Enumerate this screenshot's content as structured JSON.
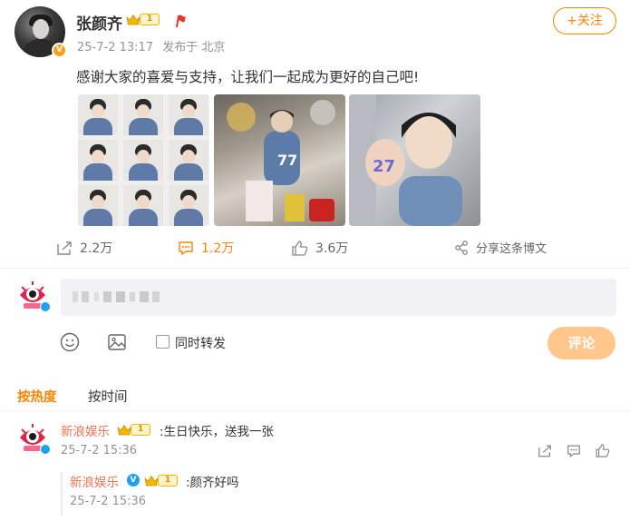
{
  "post": {
    "username": "张颜齐",
    "level": "1",
    "verified_badge": "V",
    "date": "25-7-2 13:17",
    "source": "发布于 北京",
    "follow_label": "+关注",
    "text": "感谢大家的喜爱与支持，让我们一起成为更好的自己吧!",
    "images": [
      "grid-photo-collage",
      "birthday-party-photo",
      "selfie-27-photo"
    ]
  },
  "actions": {
    "share_count": "2.2万",
    "comment_count": "1.2万",
    "like_count": "3.6万",
    "forward_label": "分享这条博文"
  },
  "composer": {
    "placeholder": "",
    "checkbox_label": "同时转发",
    "submit_label": "评论"
  },
  "sort_tabs": {
    "hot": "按热度",
    "time": "按时间"
  },
  "comments": [
    {
      "user": "新浪娱乐",
      "level": "1",
      "text": ":生日快乐，送我一张",
      "time": "25-7-2 15:36",
      "replies": [
        {
          "user": "新浪娱乐",
          "verified_badge": "V",
          "level": "1",
          "text": ":颜齐好吗",
          "time": "25-7-2 15:36"
        }
      ]
    }
  ],
  "colors": {
    "accent": "#ff8200",
    "comment_name": "#eb7350",
    "meta_gray": "#939393"
  },
  "icons": {
    "share": "share-icon",
    "comment": "comment-icon",
    "like": "thumbs-up-icon",
    "forward": "share-node-icon",
    "emoji": "emoji-icon",
    "image": "image-icon"
  }
}
